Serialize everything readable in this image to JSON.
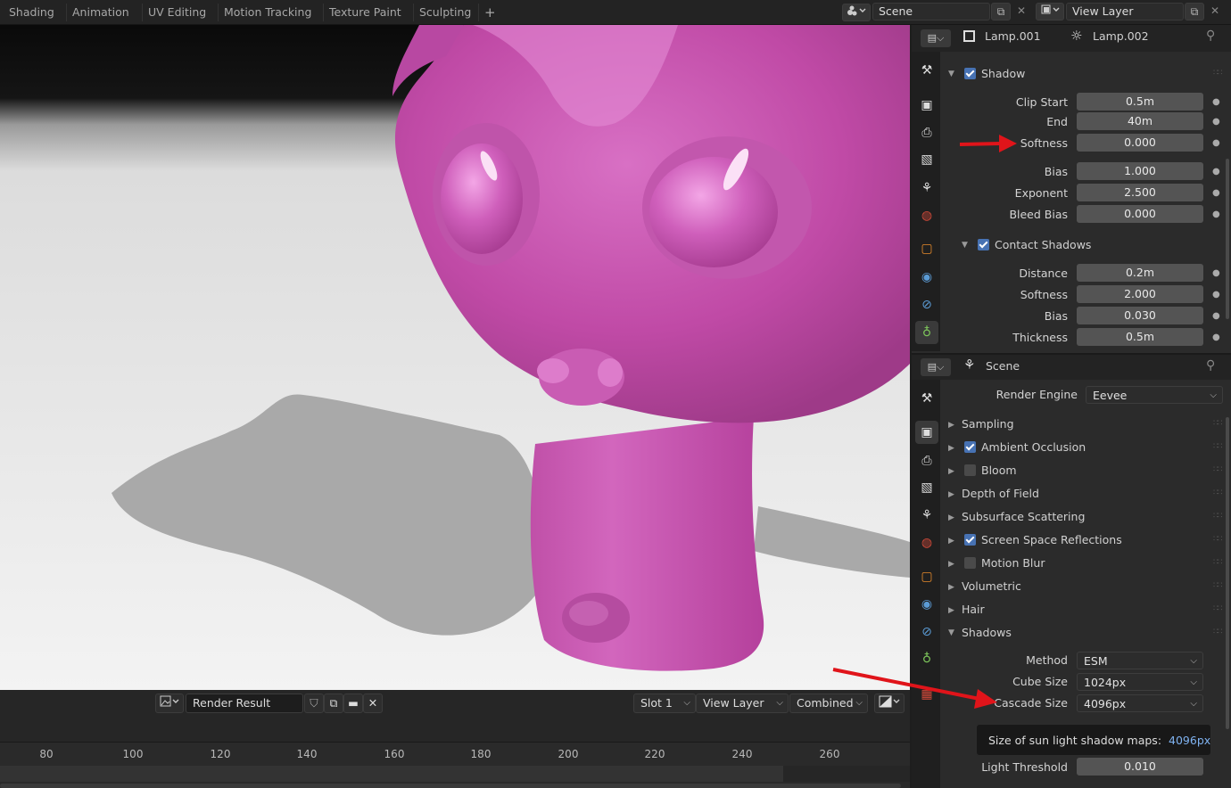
{
  "workspace_tabs": [
    "Shading",
    "Animation",
    "UV Editing",
    "Motion Tracking",
    "Texture Paint",
    "Sculpting"
  ],
  "add_tab": "+",
  "scene_field": "Scene",
  "view_layer_field": "View Layer",
  "image_editor": {
    "image_name": "Render Result",
    "slot": "Slot 1",
    "view_layer": "View Layer",
    "pass": "Combined"
  },
  "timeline": {
    "ticks": [
      "80",
      "100",
      "120",
      "140",
      "160",
      "180",
      "200",
      "220",
      "240",
      "260"
    ]
  },
  "light_panel": {
    "breadcrumb_1": "Lamp.001",
    "breadcrumb_2": "Lamp.002",
    "shadow_header": "Shadow",
    "rows": [
      {
        "label": "Clip Start",
        "value": "0.5m"
      },
      {
        "label": "End",
        "value": "40m"
      },
      {
        "label": "Softness",
        "value": "0.000"
      },
      {
        "label": "Bias",
        "value": "1.000"
      },
      {
        "label": "Exponent",
        "value": "2.500"
      },
      {
        "label": "Bleed Bias",
        "value": "0.000"
      }
    ],
    "contact_header": "Contact Shadows",
    "contact_rows": [
      {
        "label": "Distance",
        "value": "0.2m"
      },
      {
        "label": "Softness",
        "value": "2.000"
      },
      {
        "label": "Bias",
        "value": "0.030"
      },
      {
        "label": "Thickness",
        "value": "0.5m"
      }
    ]
  },
  "render_panel": {
    "breadcrumb": "Scene",
    "engine_label": "Render Engine",
    "engine_value": "Eevee",
    "sections": [
      {
        "label": "Sampling"
      },
      {
        "label": "Ambient Occlusion"
      },
      {
        "label": "Bloom"
      },
      {
        "label": "Depth of Field"
      },
      {
        "label": "Subsurface Scattering"
      },
      {
        "label": "Screen Space Reflections"
      },
      {
        "label": "Motion Blur"
      },
      {
        "label": "Volumetric"
      },
      {
        "label": "Hair"
      },
      {
        "label": "Shadows"
      }
    ],
    "method_label": "Method",
    "method_value": "ESM",
    "cube_label": "Cube Size",
    "cube_value": "1024px",
    "cascade_label": "Cascade Size",
    "cascade_value": "4096px",
    "light_threshold_label": "Light Threshold",
    "light_threshold_value": "0.010"
  },
  "tooltip": {
    "text": "Size of sun light shadow maps:",
    "value": "4096px"
  },
  "colors": {
    "accent": "#4772b3",
    "arrow": "#e0141a",
    "monkey": "#c94cb0"
  }
}
